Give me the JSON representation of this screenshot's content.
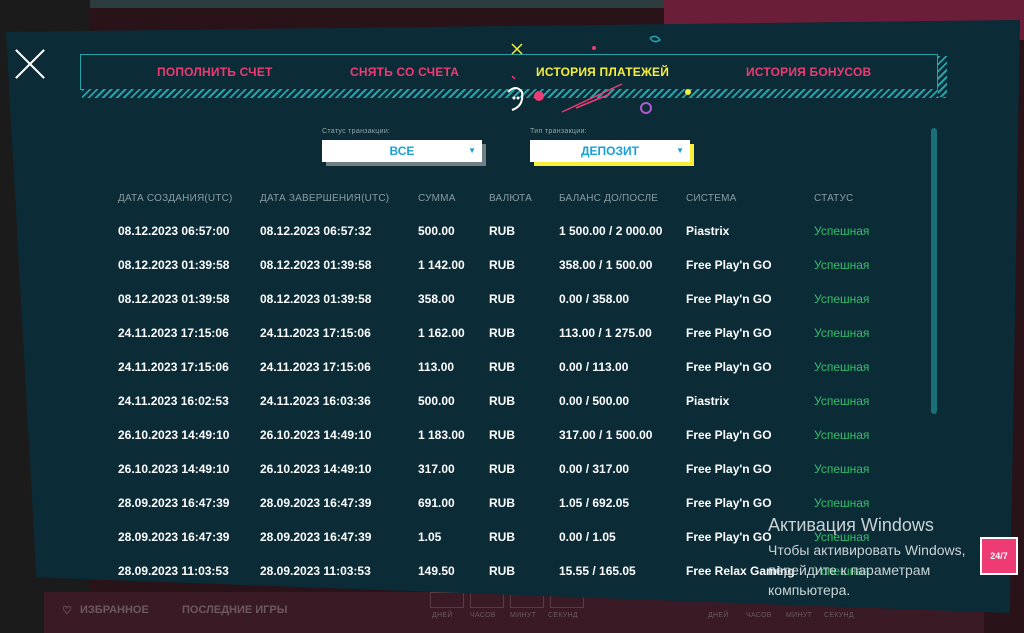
{
  "tabs": [
    {
      "label": "ПОПОЛНИТЬ СЧЕТ",
      "active": false
    },
    {
      "label": "СНЯТЬ СО СЧЕТА",
      "active": false
    },
    {
      "label": "ИСТОРИЯ ПЛАТЕЖЕЙ",
      "active": true
    },
    {
      "label": "ИСТОРИЯ БОНУСОВ",
      "active": false
    }
  ],
  "filters": {
    "status_label": "Статус транзакции:",
    "status_value": "ВСЕ",
    "type_label": "Тип транзакции:",
    "type_value": "ДЕПОЗИТ"
  },
  "table": {
    "headers": [
      "ДАТА СОЗДАНИЯ(UTC)",
      "ДАТА ЗАВЕРШЕНИЯ(UTC)",
      "СУММА",
      "ВАЛЮТА",
      "БАЛАНС ДО/ПОСЛЕ",
      "СИСТЕМА",
      "СТАТУС"
    ],
    "rows": [
      [
        "08.12.2023 06:57:00",
        "08.12.2023 06:57:32",
        "500.00",
        "RUB",
        "1 500.00 / 2 000.00",
        "Piastrix",
        "Успешная"
      ],
      [
        "08.12.2023 01:39:58",
        "08.12.2023 01:39:58",
        "1 142.00",
        "RUB",
        "358.00 / 1 500.00",
        "Free Play'n GO",
        "Успешная"
      ],
      [
        "08.12.2023 01:39:58",
        "08.12.2023 01:39:58",
        "358.00",
        "RUB",
        "0.00 / 358.00",
        "Free Play'n GO",
        "Успешная"
      ],
      [
        "24.11.2023 17:15:06",
        "24.11.2023 17:15:06",
        "1 162.00",
        "RUB",
        "113.00 / 1 275.00",
        "Free Play'n GO",
        "Успешная"
      ],
      [
        "24.11.2023 17:15:06",
        "24.11.2023 17:15:06",
        "113.00",
        "RUB",
        "0.00 / 113.00",
        "Free Play'n GO",
        "Успешная"
      ],
      [
        "24.11.2023 16:02:53",
        "24.11.2023 16:03:36",
        "500.00",
        "RUB",
        "0.00 / 500.00",
        "Piastrix",
        "Успешная"
      ],
      [
        "26.10.2023 14:49:10",
        "26.10.2023 14:49:10",
        "1 183.00",
        "RUB",
        "317.00 / 1 500.00",
        "Free Play'n GO",
        "Успешная"
      ],
      [
        "26.10.2023 14:49:10",
        "26.10.2023 14:49:10",
        "317.00",
        "RUB",
        "0.00 / 317.00",
        "Free Play'n GO",
        "Успешная"
      ],
      [
        "28.09.2023 16:47:39",
        "28.09.2023 16:47:39",
        "691.00",
        "RUB",
        "1.05 / 692.05",
        "Free Play'n GO",
        "Успешная"
      ],
      [
        "28.09.2023 16:47:39",
        "28.09.2023 16:47:39",
        "1.05",
        "RUB",
        "0.00 / 1.05",
        "Free Play'n GO",
        "Успешная"
      ],
      [
        "28.09.2023 11:03:53",
        "28.09.2023 11:03:53",
        "149.50",
        "RUB",
        "15.55 / 165.05",
        "Free Relax Gaming",
        "Успешная"
      ]
    ]
  },
  "background": {
    "favorites": "ИЗБРАННОЕ",
    "recent_games": "ПОСЛЕДНИЕ ИГРЫ",
    "counter_labels": [
      "ДНЕЙ",
      "ЧАСОВ",
      "МИНУТ",
      "СЕКУНД"
    ]
  },
  "watermark": {
    "title": "Активация Windows",
    "text": "Чтобы активировать Windows, перейдите к параметрам компьютера."
  },
  "support_badge": "24/7",
  "colors": {
    "modal_bg": "#0b2b36",
    "tab_inactive": "#ee3b74",
    "tab_active": "#f7ef3a",
    "frame": "#27a2a8",
    "status_success": "#34c06a",
    "select_text": "#1aa0d8"
  }
}
